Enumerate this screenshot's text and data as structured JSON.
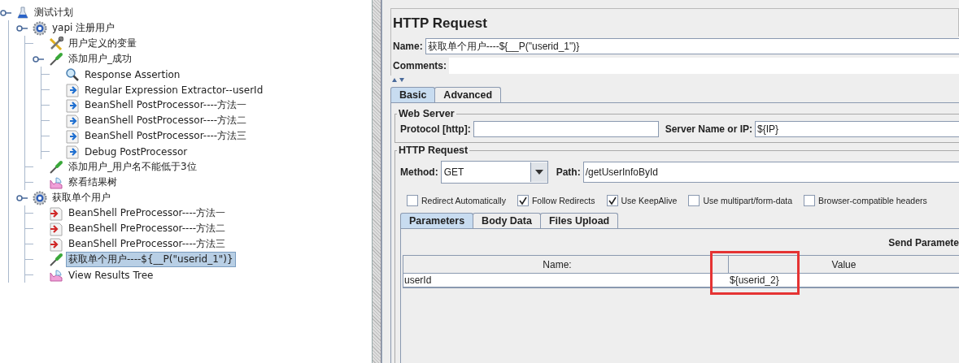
{
  "tree": [
    {
      "label": "测试计划",
      "kind": "plan",
      "expanded": true,
      "selected": false,
      "children": [
        {
          "label": "yapi 注册用户",
          "kind": "thread-group",
          "expanded": true,
          "selected": false,
          "children": [
            {
              "label": "用户定义的变量",
              "kind": "config",
              "selected": false
            },
            {
              "label": "添加用户_成功",
              "kind": "sampler",
              "expanded": true,
              "selected": false,
              "children": [
                {
                  "label": "Response Assertion",
                  "kind": "assertion",
                  "selected": false
                },
                {
                  "label": "Regular Expression Extractor--userId",
                  "kind": "post-processor",
                  "selected": false
                },
                {
                  "label": "BeanShell PostProcessor----方法一",
                  "kind": "post-processor",
                  "selected": false
                },
                {
                  "label": "BeanShell PostProcessor----方法二",
                  "kind": "post-processor",
                  "selected": false
                },
                {
                  "label": "BeanShell PostProcessor----方法三",
                  "kind": "post-processor",
                  "selected": false
                },
                {
                  "label": "Debug PostProcessor",
                  "kind": "post-processor",
                  "selected": false
                }
              ]
            },
            {
              "label": "添加用户_用户名不能低于3位",
              "kind": "sampler",
              "selected": false
            },
            {
              "label": "察看结果树",
              "kind": "listener",
              "selected": false
            }
          ]
        },
        {
          "label": "获取单个用户",
          "kind": "thread-group",
          "expanded": true,
          "selected": false,
          "children": [
            {
              "label": "BeanShell PreProcessor----方法一",
              "kind": "pre-processor",
              "selected": false
            },
            {
              "label": "BeanShell PreProcessor----方法二",
              "kind": "pre-processor",
              "selected": false
            },
            {
              "label": "BeanShell PreProcessor----方法三",
              "kind": "pre-processor",
              "selected": false
            },
            {
              "label": "获取单个用户----${__P(\"userid_1\")}",
              "kind": "sampler",
              "selected": true
            },
            {
              "label": "View Results Tree",
              "kind": "listener",
              "selected": false
            }
          ]
        }
      ]
    }
  ],
  "editor": {
    "title": "HTTP Request",
    "name_label": "Name:",
    "name_value": "获取单个用户----${__P(\"userid_1\")}",
    "comments_label": "Comments:",
    "tabs": [
      {
        "label": "Basic",
        "selected": true
      },
      {
        "label": "Advanced",
        "selected": false
      }
    ],
    "web_server": {
      "title": "Web Server",
      "protocol_label": "Protocol [http]:",
      "server_label": "Server Name or IP:",
      "server_value": "${IP}"
    },
    "http_request": {
      "title": "HTTP Request",
      "method_label": "Method:",
      "method_value": "GET",
      "path_label": "Path:",
      "path_value": "/getUserInfoById",
      "options": [
        {
          "label": "Redirect Automatically",
          "checked": false
        },
        {
          "label": "Follow Redirects",
          "checked": true
        },
        {
          "label": "Use KeepAlive",
          "checked": true
        },
        {
          "label": "Use multipart/form-data",
          "checked": false
        },
        {
          "label": "Browser-compatible headers",
          "checked": false
        }
      ],
      "subtabs": [
        {
          "label": "Parameters",
          "selected": true
        },
        {
          "label": "Body Data",
          "selected": false
        },
        {
          "label": "Files Upload",
          "selected": false
        }
      ],
      "send_parameters_label": "Send Paramete",
      "table": {
        "columns": [
          "Name:",
          "Value"
        ],
        "rows": [
          {
            "name": "userId",
            "value": "${userid_2}"
          }
        ]
      }
    }
  }
}
